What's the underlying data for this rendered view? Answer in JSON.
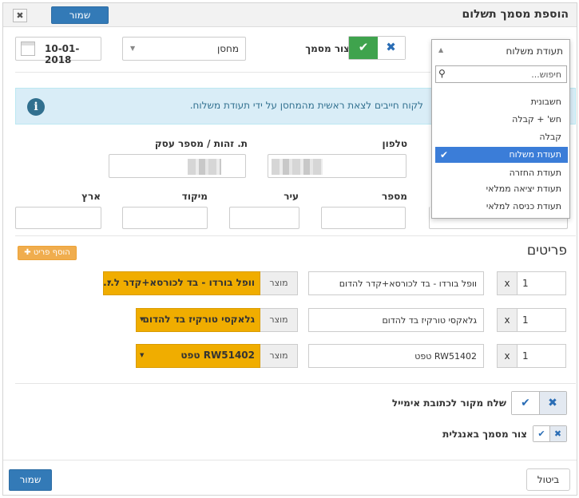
{
  "header": {
    "title": "הוספת מסמך תשלום",
    "save_label": "שמור",
    "close_glyph": "✖"
  },
  "top_row": {
    "date_value": "10-01-2018",
    "warehouse_value": "מחסן",
    "create_doc_label": "צור מסמך",
    "doc_type_value": "תעודת משלוח"
  },
  "alert": {
    "text": "לקוח חייבים לצאת ראשית מהמחסן על ידי תעודת משלוח.",
    "icon_glyph": "i"
  },
  "doc_type_dropdown": {
    "selected": "תעודת משלוח",
    "search_placeholder": "חיפוש...",
    "items": [
      {
        "label": "חשבונית"
      },
      {
        "label": "חש' + קבלה"
      },
      {
        "label": "קבלה"
      },
      {
        "label": "תעודת משלוח"
      },
      {
        "label": "תעודת החזרה"
      },
      {
        "label": "תעודת יציאה ממלאי"
      },
      {
        "label": "תעודת כניסה למלאי"
      }
    ]
  },
  "customer": {
    "id_label": "ת. זהות / מספר עסק",
    "phone_label": "טלפון",
    "number_label": "מספר",
    "city_label": "עיר",
    "zip_label": "מיקוד",
    "country_label": "ארץ"
  },
  "items_section": {
    "title": "פריטים",
    "add_label": "הוסף פריט",
    "product_addon": "מוצר",
    "x_label": "x",
    "rows": [
      {
        "qty": "1",
        "desc": "וופל בורדו - בד לכורסא+קדר להדום",
        "product": "וופל בורדו - בד לכורסא+קדר ל..."
      },
      {
        "qty": "1",
        "desc": "גלאקסי טורקיז בד להדום",
        "product": "גלאקסי טורקיז בד להדום"
      },
      {
        "qty": "1",
        "desc": "RW51402 טפט",
        "product": "RW51402 טפט"
      }
    ]
  },
  "options": {
    "send_email_label": "שלח מקור לכתובת אימייל",
    "english_label": "צור מסמך באנגלית"
  },
  "footer": {
    "cancel_label": "ביטול",
    "save_label": "שמור"
  }
}
